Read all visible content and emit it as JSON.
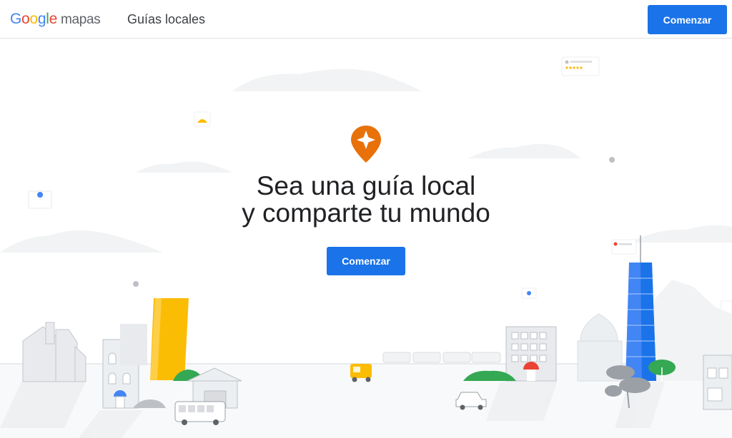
{
  "header": {
    "logo_brand": "Google",
    "logo_product": "mapas",
    "nav_link": "Guías locales",
    "cta_label": "Comenzar"
  },
  "hero": {
    "title_line1": "Sea una guía local",
    "title_line2": "y comparte tu mundo",
    "cta_label": "Comenzar",
    "icon": "local-guides-star-pin-icon"
  },
  "colors": {
    "accent": "#1a73e8",
    "pin_orange": "#e8710a",
    "building_yellow": "#fbbc04",
    "tower_blue": "#4285f4",
    "tree_green": "#34a853"
  }
}
